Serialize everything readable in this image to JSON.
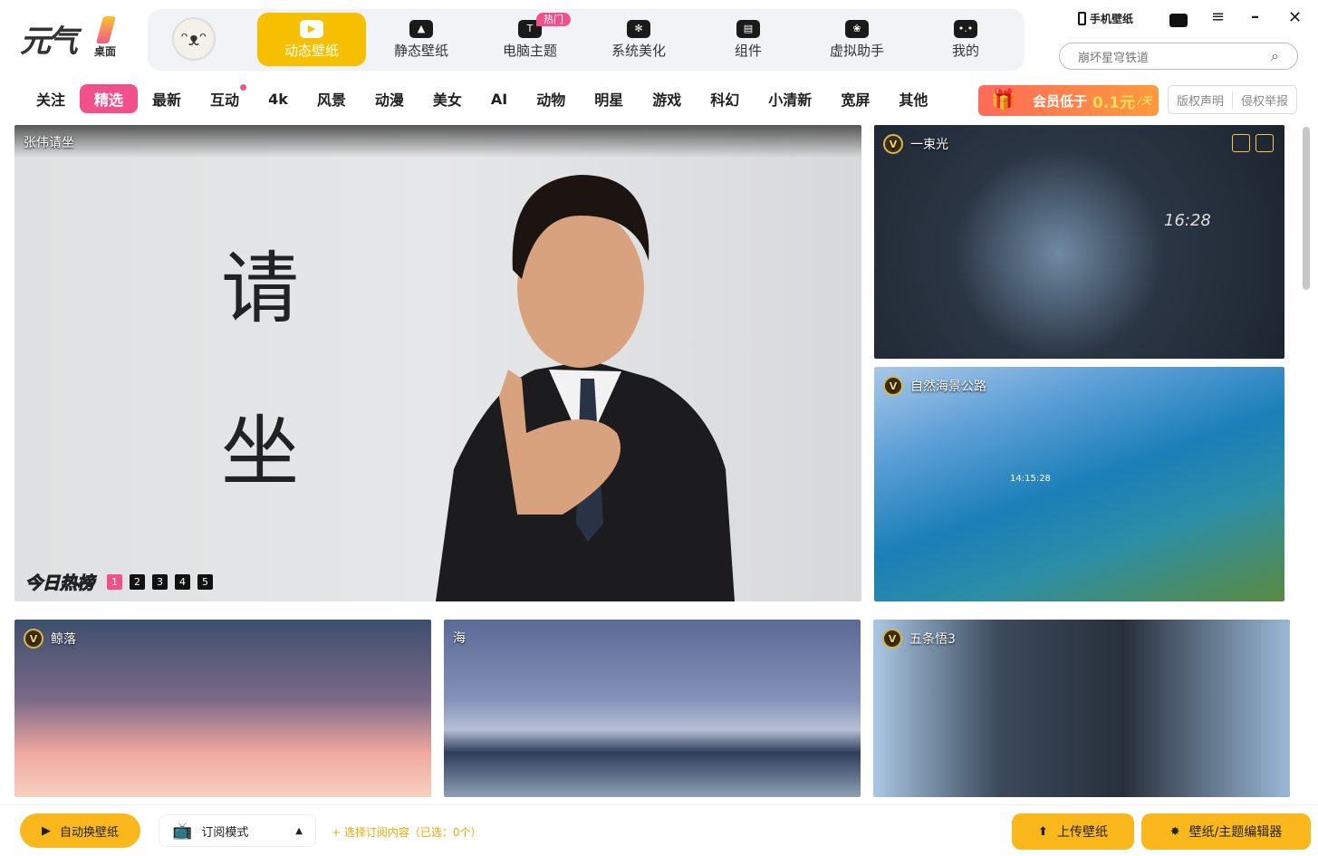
{
  "app": {
    "logo_text": "元气",
    "logo_sub": "桌面"
  },
  "nav": {
    "items": [
      {
        "label": "动态壁纸",
        "icon": "play-tv-icon",
        "active": true
      },
      {
        "label": "静态壁纸",
        "icon": "image-icon"
      },
      {
        "label": "电脑主题",
        "icon": "tshirt-icon",
        "badge": "热门"
      },
      {
        "label": "系统美化",
        "icon": "flower-icon"
      },
      {
        "label": "组件",
        "icon": "widget-icon"
      },
      {
        "label": "虚拟助手",
        "icon": "paw-icon"
      },
      {
        "label": "我的",
        "icon": "face-icon"
      }
    ]
  },
  "topright": {
    "phone_wallpaper": "手机壁纸",
    "search_placeholder": "崩坏星穹铁道"
  },
  "categories": [
    {
      "label": "关注"
    },
    {
      "label": "精选",
      "active": true
    },
    {
      "label": "最新"
    },
    {
      "label": "互动",
      "dot": true
    },
    {
      "label": "4k"
    },
    {
      "label": "风景"
    },
    {
      "label": "动漫"
    },
    {
      "label": "美女"
    },
    {
      "label": "AI"
    },
    {
      "label": "动物"
    },
    {
      "label": "明星"
    },
    {
      "label": "游戏"
    },
    {
      "label": "科幻"
    },
    {
      "label": "小清新"
    },
    {
      "label": "宽屏"
    },
    {
      "label": "其他"
    }
  ],
  "vip": {
    "text": "会员低于",
    "price": "0.1元",
    "unit": "/天"
  },
  "links": {
    "copyright": "版权声明",
    "report": "侵权举报"
  },
  "banner": {
    "title": "张伟请坐",
    "char1": "请",
    "char2": "坐",
    "rank_label": "今日热榜",
    "pages": [
      "1",
      "2",
      "3",
      "4",
      "5"
    ],
    "current_page": "1"
  },
  "cards": [
    {
      "title": "一束光",
      "vip": true,
      "clock": "16:28"
    },
    {
      "title": "自然海景公路",
      "vip": true,
      "clock": "14:15:28"
    },
    {
      "title": "鲸落",
      "vip": true
    },
    {
      "title": "海",
      "vip": false
    },
    {
      "title": "五条悟3",
      "vip": true
    }
  ],
  "bottom": {
    "auto_change": "自动换壁纸",
    "mode": "订阅模式",
    "select_sub": "+ 选择订阅内容（已选：0个）",
    "upload": "上传壁纸",
    "editor": "壁纸/主题编辑器"
  },
  "colors": {
    "accent": "#f6c000",
    "pink": "#f2508a",
    "button": "#fbb81c"
  }
}
